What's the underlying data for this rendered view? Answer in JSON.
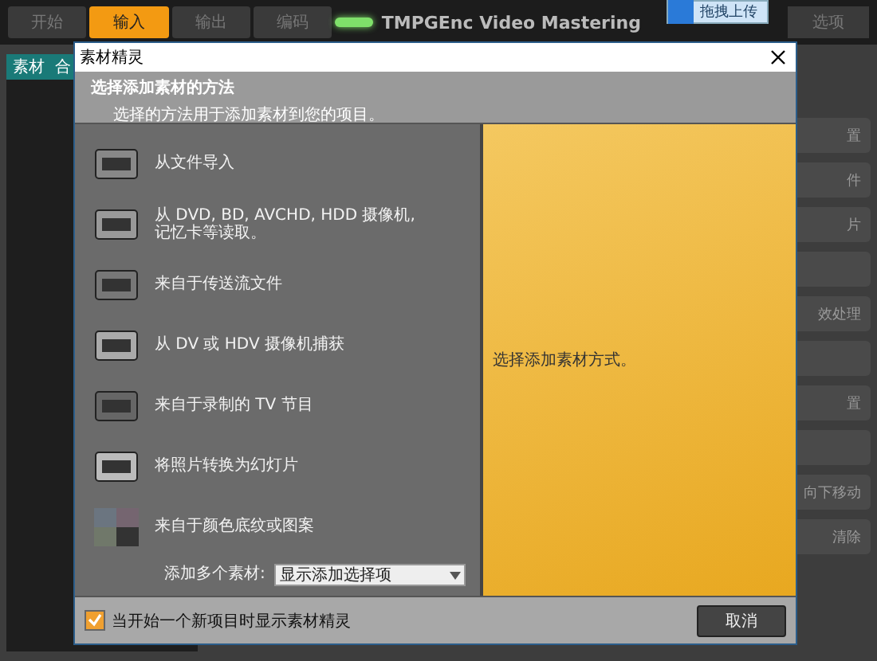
{
  "app": {
    "tabs": [
      {
        "label": "开始",
        "selected": false
      },
      {
        "label": "输入",
        "selected": true
      },
      {
        "label": "输出",
        "selected": false
      },
      {
        "label": "编码",
        "selected": false
      }
    ],
    "logo": "TMPGEnc Video Mastering",
    "options": "选项",
    "upload_button": "拖拽上传",
    "left_tab": "素材  合",
    "side_buttons": [
      {
        "kind": "text",
        "label": "置"
      },
      {
        "kind": "text",
        "label": "件"
      },
      {
        "kind": "text",
        "label": "片"
      },
      {
        "kind": "blank"
      },
      {
        "kind": "text",
        "label": "效处理"
      },
      {
        "kind": "blank"
      },
      {
        "kind": "text",
        "label": "置"
      },
      {
        "kind": "blank"
      },
      {
        "kind": "text",
        "label": "向下移动"
      },
      {
        "kind": "text",
        "label": "清除"
      }
    ]
  },
  "dialog": {
    "title": "素材精灵",
    "heading": "选择添加素材的方法",
    "subheading": "选择的方法用于添加素材到您的项目。",
    "methods": [
      {
        "kind": "new",
        "label": "从文件导入"
      },
      {
        "kind": "disc",
        "label": "从 DVD, BD, AVCHD, HDD 摄像机,\n记忆卡等读取。"
      },
      {
        "kind": "ts",
        "label": "来自于传送流文件"
      },
      {
        "kind": "camera",
        "label": "从 DV 或 HDV 摄像机捕获"
      },
      {
        "kind": "tv",
        "label": "来自于录制的 TV 节目"
      },
      {
        "kind": "photo",
        "label": "将照片转换为幻灯片"
      },
      {
        "kind": "color",
        "label": "来自于颜色底纹或图案"
      }
    ],
    "multi_label": "添加多个素材:",
    "multi_value": "显示添加选择项",
    "info": "选择添加素材方式。",
    "show_on_start": {
      "label": "当开始一个新项目时显示素材精灵",
      "checked": true
    },
    "cancel": "取消"
  }
}
